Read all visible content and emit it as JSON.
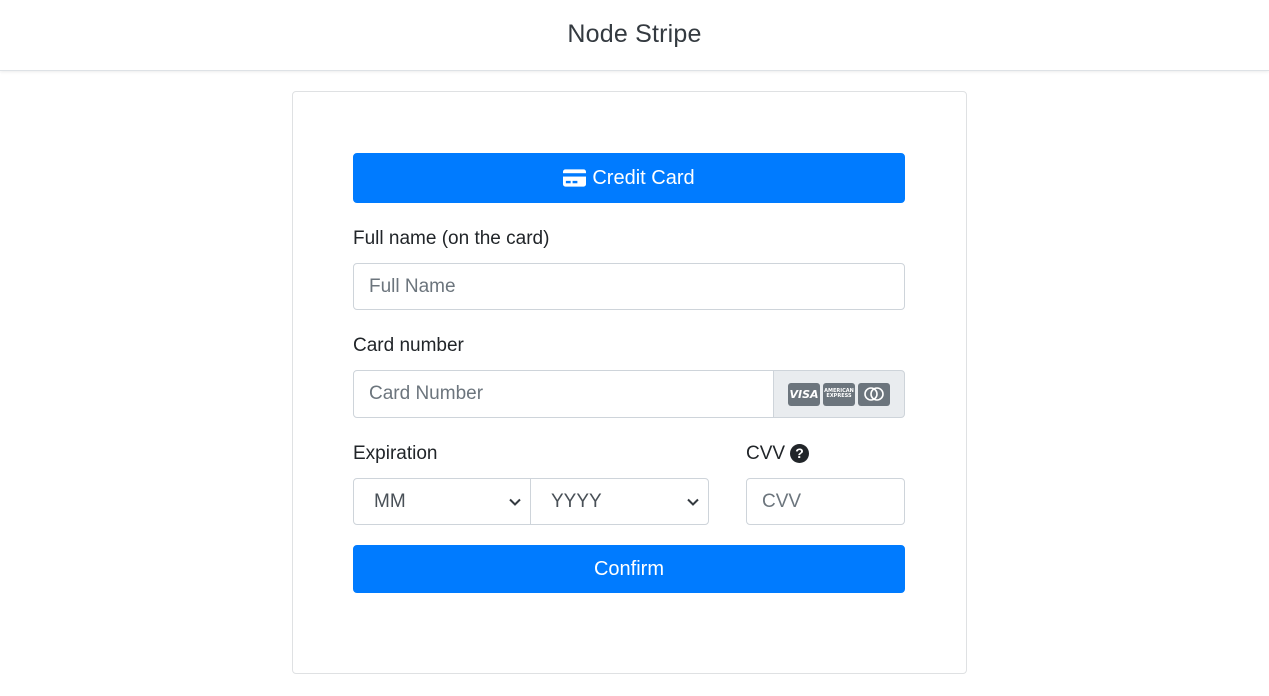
{
  "navbar": {
    "brand": "Node Stripe"
  },
  "tab": {
    "label": "Credit Card",
    "icon": "credit-card-icon"
  },
  "fullname": {
    "label": "Full name (on the card)",
    "placeholder": "Full Name"
  },
  "cardnumber": {
    "label": "Card number",
    "placeholder": "Card Number",
    "brand_icons": [
      "visa-icon",
      "amex-icon",
      "mastercard-icon"
    ],
    "visa_text": "VISA",
    "amex_text": "AMERICAN EXPRESS"
  },
  "expiration": {
    "label": "Expiration",
    "month_value": "MM",
    "year_value": "YYYY"
  },
  "cvv": {
    "label": "CVV",
    "placeholder": "CVV",
    "help": "?"
  },
  "confirm": {
    "label": "Confirm"
  },
  "colors": {
    "primary": "#007bff",
    "addon_bg": "#e9ecef",
    "border": "#ced4da"
  }
}
